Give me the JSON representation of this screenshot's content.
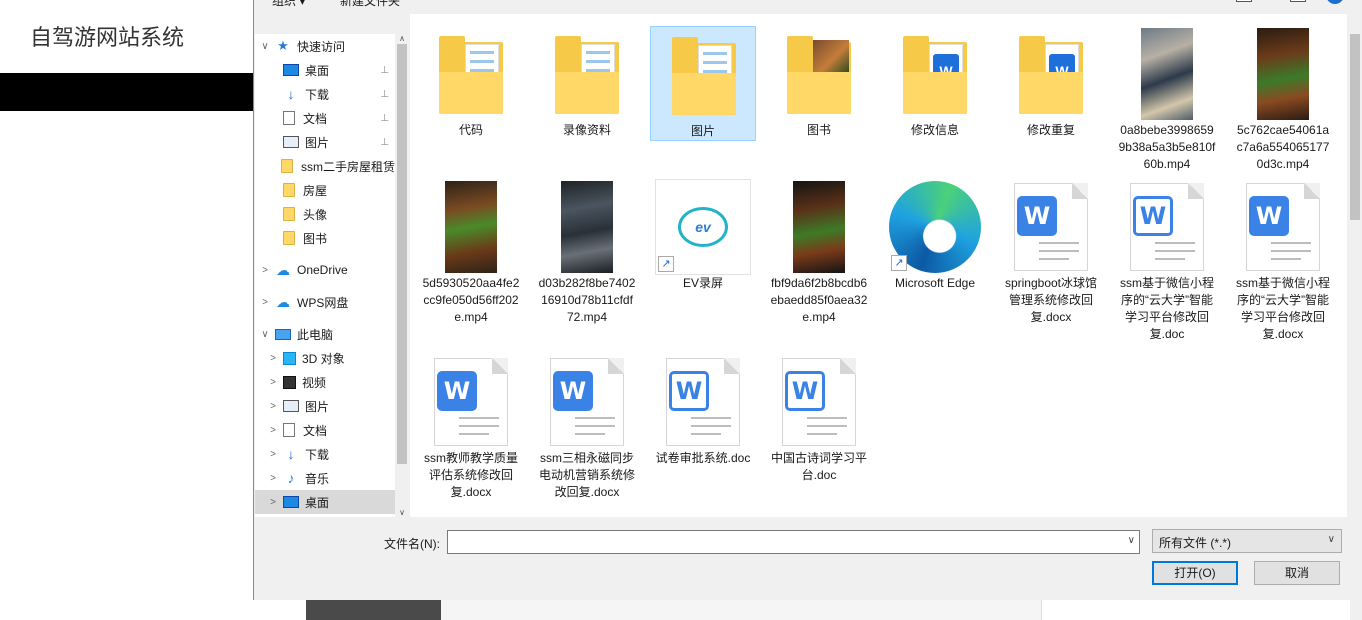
{
  "background": {
    "site_title": "自驾游网站系统"
  },
  "toolbar": {
    "organize_label": "组织 ▾",
    "new_folder_label": "新建文件夹",
    "help_label": "?"
  },
  "nav": {
    "items": [
      {
        "label": "快速访问",
        "icon": "star-icon",
        "indent": 0,
        "chev": "∨",
        "pinned": false
      },
      {
        "label": "桌面",
        "icon": "desktop-icon",
        "indent": 1,
        "pinned": true
      },
      {
        "label": "下载",
        "icon": "download-icon",
        "indent": 1,
        "pinned": true
      },
      {
        "label": "文档",
        "icon": "document-icon",
        "indent": 1,
        "pinned": true
      },
      {
        "label": "图片",
        "icon": "picture-icon",
        "indent": 1,
        "pinned": true
      },
      {
        "label": "ssm二手房屋租赁",
        "icon": "folder-icon",
        "indent": 1,
        "pinned": false
      },
      {
        "label": "房屋",
        "icon": "folder-icon",
        "indent": 1,
        "pinned": false
      },
      {
        "label": "头像",
        "icon": "folder-icon",
        "indent": 1,
        "pinned": false
      },
      {
        "label": "图书",
        "icon": "folder-icon",
        "indent": 1,
        "pinned": false
      },
      {
        "label": "OneDrive",
        "icon": "cloud-icon",
        "indent": 0,
        "chev": ">",
        "pinned": false
      },
      {
        "label": "WPS网盘",
        "icon": "cloud-icon",
        "indent": 0,
        "chev": ">",
        "pinned": false
      },
      {
        "label": "此电脑",
        "icon": "computer-icon",
        "indent": 0,
        "chev": "∨",
        "pinned": false
      },
      {
        "label": "3D 对象",
        "icon": "3d-objects-icon",
        "indent": 1,
        "chev": ">",
        "pinned": false
      },
      {
        "label": "视频",
        "icon": "video-icon",
        "indent": 1,
        "chev": ">",
        "pinned": false
      },
      {
        "label": "图片",
        "icon": "picture-icon",
        "indent": 1,
        "chev": ">",
        "pinned": false
      },
      {
        "label": "文档",
        "icon": "document-icon",
        "indent": 1,
        "chev": ">",
        "pinned": false
      },
      {
        "label": "下载",
        "icon": "download-icon",
        "indent": 1,
        "chev": ">",
        "pinned": false
      },
      {
        "label": "音乐",
        "icon": "music-icon",
        "indent": 1,
        "chev": ">",
        "pinned": false
      },
      {
        "label": "桌面",
        "icon": "desktop-icon",
        "indent": 1,
        "chev": ">",
        "pinned": false,
        "selected": true
      }
    ],
    "pin_glyph": "📌"
  },
  "files": [
    {
      "label": "代码",
      "kind": "folder",
      "variant": "paper"
    },
    {
      "label": "录像资料",
      "kind": "folder",
      "variant": "paper"
    },
    {
      "label": "图片",
      "kind": "folder",
      "variant": "paper",
      "selected": true
    },
    {
      "label": "图书",
      "kind": "folder",
      "variant": "photo"
    },
    {
      "label": "修改信息",
      "kind": "folder",
      "variant": "doc"
    },
    {
      "label": "修改重复",
      "kind": "folder",
      "variant": "doc"
    },
    {
      "label": "0a8bebe39986599b38a5a3b5e810f60b.mp4",
      "kind": "video",
      "variant": "vt1"
    },
    {
      "label": "5c762cae54061ac7a6a5540651770d3c.mp4",
      "kind": "video",
      "variant": "vt2"
    },
    {
      "label": "5d5930520aa4fe2cc9fe050d56ff202e.mp4",
      "kind": "video",
      "variant": "vt3"
    },
    {
      "label": "d03b282f8be740216910d78b11cfdf72.mp4",
      "kind": "video",
      "variant": "vt4"
    },
    {
      "label": "EV录屏",
      "kind": "app",
      "variant": "ev"
    },
    {
      "label": "fbf9da6f2b8bcdb6ebaedd85f0aea32e.mp4",
      "kind": "video",
      "variant": "vt5"
    },
    {
      "label": "Microsoft Edge",
      "kind": "app",
      "variant": "edge"
    },
    {
      "label": "springboot冰球馆管理系统修改回复.docx",
      "kind": "wps",
      "variant": "solid"
    },
    {
      "label": "ssm基于微信小程序的“云大学”智能学习平台修改回复.doc",
      "kind": "wps",
      "variant": "outline"
    },
    {
      "label": "ssm基于微信小程序的“云大学”智能学习平台修改回复.docx",
      "kind": "wps",
      "variant": "solid"
    },
    {
      "label": "ssm教师教学质量评估系统修改回复.docx",
      "kind": "wps",
      "variant": "solid"
    },
    {
      "label": "ssm三相永磁同步电动机营销系统修改回复.docx",
      "kind": "wps",
      "variant": "solid"
    },
    {
      "label": "试卷审批系统.doc",
      "kind": "wps",
      "variant": "outline"
    },
    {
      "label": "中国古诗词学习平台.doc",
      "kind": "wps",
      "variant": "outline"
    }
  ],
  "footer": {
    "filename_label": "文件名(N):",
    "filename_value": "",
    "filetype_selected": "所有文件 (*.*)",
    "open_label": "打开(O)",
    "cancel_label": "取消"
  },
  "glyphs": {
    "shortcut": "↗",
    "wps_letter": "W",
    "dropdown": "∨",
    "scroll_up": "∧",
    "scroll_down": "∨"
  }
}
